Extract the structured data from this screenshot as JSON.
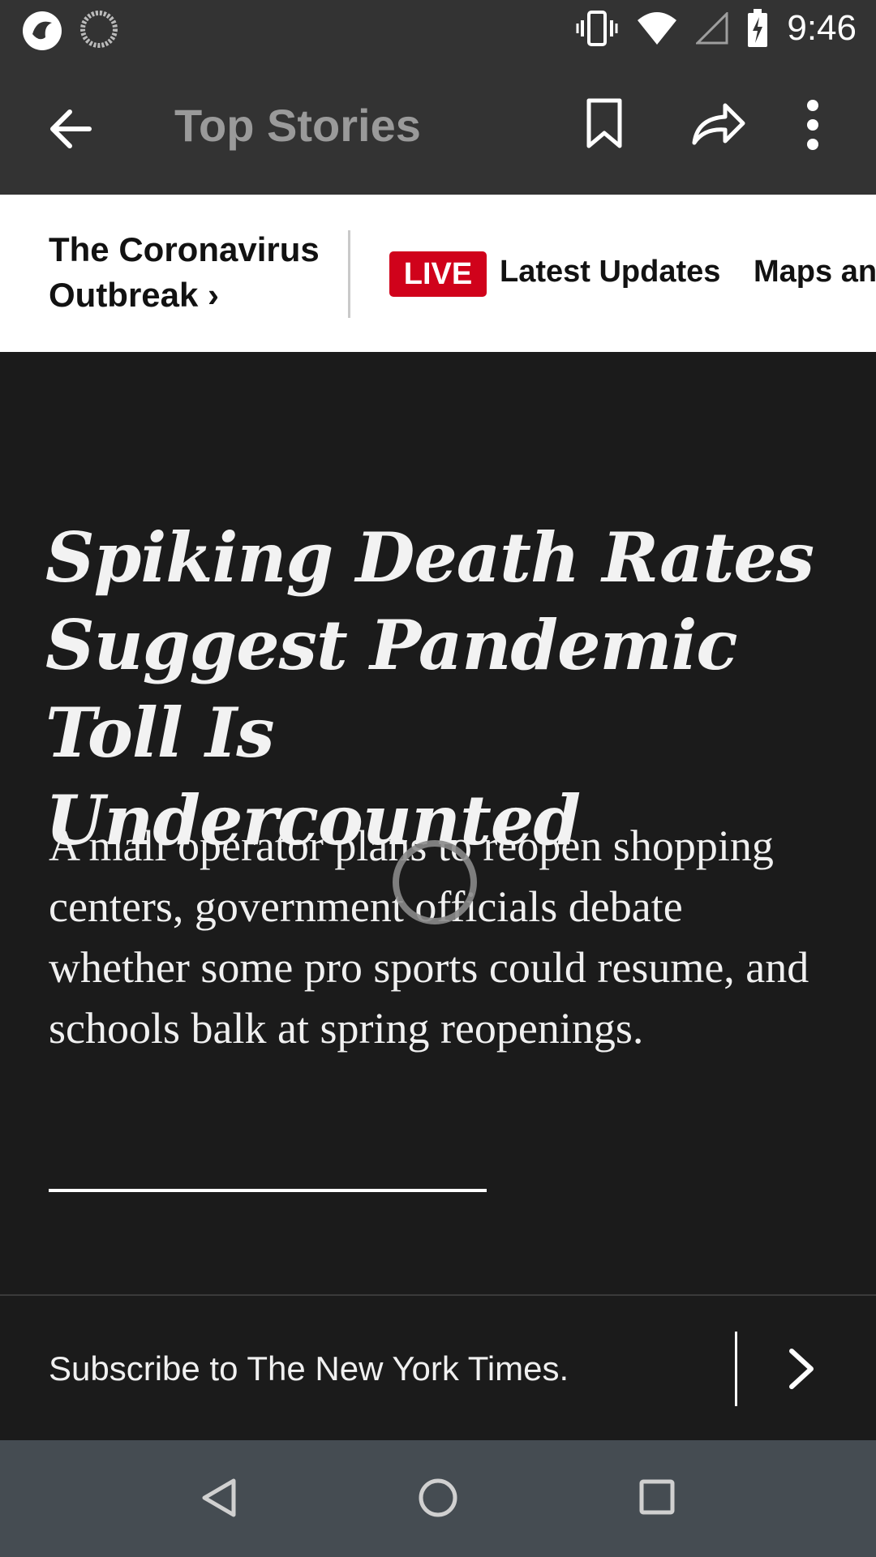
{
  "status_bar": {
    "time": "9:46",
    "icons": [
      "app-notification-icon",
      "sync-icon",
      "vibrate-icon",
      "wifi-icon",
      "signal-icon",
      "battery-charging-icon"
    ]
  },
  "app_bar": {
    "title": "Top Stories",
    "icons": [
      "back-arrow-icon",
      "bookmark-icon",
      "share-icon",
      "more-vert-icon"
    ]
  },
  "topic_bar": {
    "title": "The Coronavirus Outbreak ›",
    "live_badge": "LIVE",
    "links": [
      "Latest Updates",
      "Maps and"
    ]
  },
  "article": {
    "headline": "Spiking Death Rates Suggest Pandemic Toll Is Undercounted",
    "summary": "A mall operator plans to reopen shopping centers, government officials debate whether some pro sports could resume, and schools balk at spring reopenings."
  },
  "subscribe": {
    "text": "Subscribe to The New York Times."
  },
  "nav_bar": {
    "buttons": [
      "back-triangle-icon",
      "home-circle-icon",
      "recents-square-icon"
    ]
  },
  "colors": {
    "live_red": "#d0021b",
    "dark_bg": "#1b1b1b",
    "bar_bg": "#333333"
  }
}
